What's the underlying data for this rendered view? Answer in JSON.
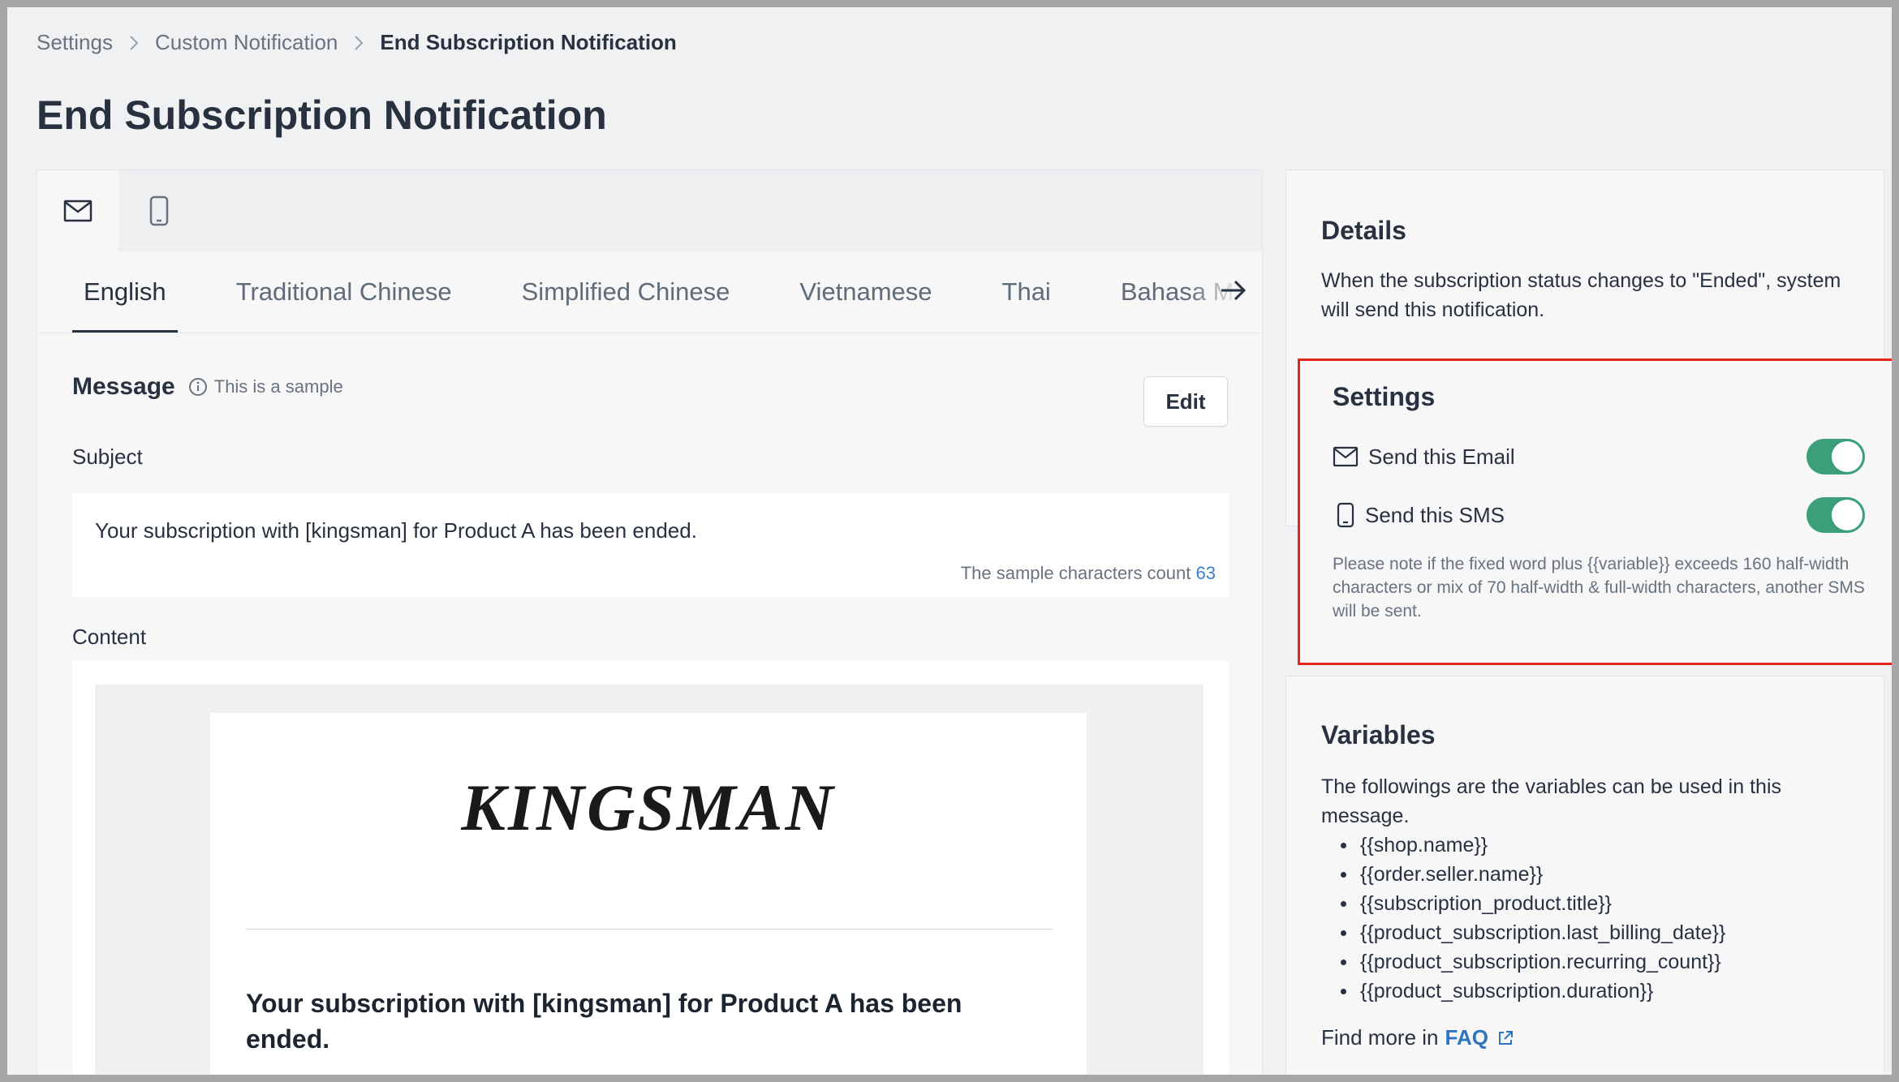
{
  "breadcrumb": {
    "items": [
      "Settings",
      "Custom Notification"
    ],
    "current": "End Subscription Notification"
  },
  "page": {
    "title": "End Subscription Notification"
  },
  "channels": [
    {
      "icon": "envelope-icon",
      "active": true
    },
    {
      "icon": "mobile-phone-icon",
      "active": false
    }
  ],
  "languages": {
    "tabs": [
      "English",
      "Traditional Chinese",
      "Simplified Chinese",
      "Vietnamese",
      "Thai",
      "Bahasa Malay"
    ],
    "active": "English"
  },
  "message": {
    "label": "Message",
    "sample_note": "This is a sample",
    "edit_label": "Edit",
    "subject_label": "Subject",
    "subject_text": "Your subscription with [kingsman] for Product A has been ended.",
    "char_count_label": "The sample characters count",
    "char_count": "63",
    "content_label": "Content",
    "email_logo": "KINGSMAN",
    "email_heading": "Your subscription with [kingsman] for Product A has been ended."
  },
  "details": {
    "title": "Details",
    "text": "When the subscription status changes to \"Ended\", system will send this notification."
  },
  "settings": {
    "title": "Settings",
    "send_email_label": "Send this Email",
    "send_sms_label": "Send this SMS",
    "send_email_on": true,
    "send_sms_on": true,
    "sms_note": "Please note if the fixed word plus {{variable}} exceeds 160 half-width characters or mix of 70 half-width & full-width characters, another SMS will be sent."
  },
  "variables": {
    "title": "Variables",
    "intro": "The followings are the variables can be used in this message.",
    "items": [
      "{{shop.name}}",
      "{{order.seller.name}}",
      "{{subscription_product.title}}",
      "{{product_subscription.last_billing_date}}",
      "{{product_subscription.recurring_count}}",
      "{{product_subscription.duration}}"
    ],
    "find_more_label": "Find more in",
    "faq_label": "FAQ"
  },
  "colors": {
    "toggle_on": "#3ba07a",
    "highlight_border": "#e2261b",
    "link": "#2f74c0"
  }
}
